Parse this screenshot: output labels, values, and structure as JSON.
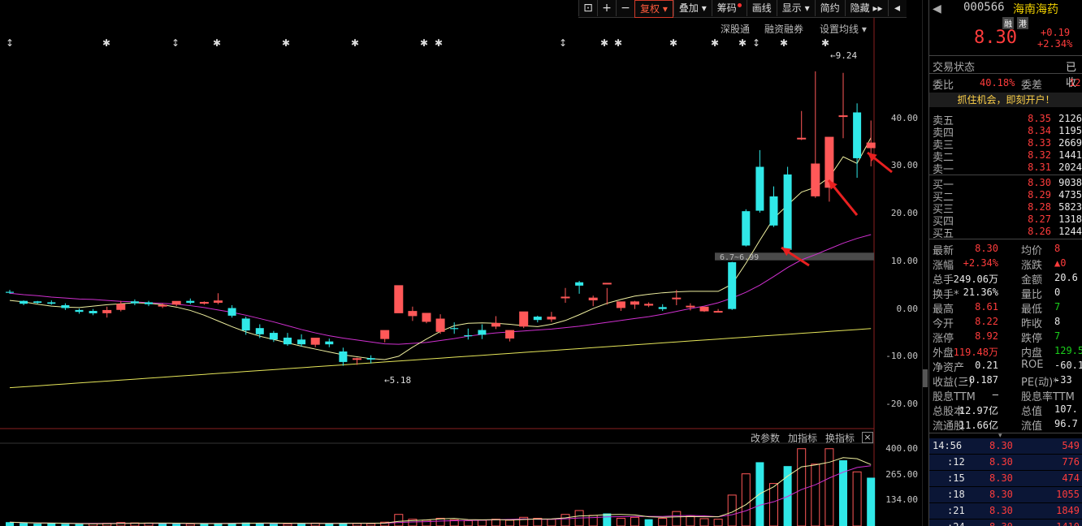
{
  "toolbar": {
    "buttons": [
      "+",
      "−"
    ],
    "fuquan": "复权",
    "diejia": "叠加",
    "choumа": "筹码",
    "huaxian": "画线",
    "xianshi": "显示",
    "jianyue": "简约",
    "yincang": "隐藏"
  },
  "chart_links": {
    "shengutong": "深股通",
    "rongzi": "融资融券",
    "junxian": "设置均线"
  },
  "annotations": {
    "high": "9.24",
    "low": "5.18",
    "range": "6.7~6.99"
  },
  "price_axis": [
    "40.00",
    "30.00",
    "20.00",
    "10.00",
    "0.00",
    "-10.00",
    "-20.00"
  ],
  "vol_axis": [
    "400.00",
    "265.00",
    "134.00"
  ],
  "indicator_bar": {
    "gaicanshu": "改参数",
    "jiazhibiao": "加指标",
    "huanzhibiao": "换指标",
    "close": "×"
  },
  "stock": {
    "code": "000566",
    "name": "海南海药",
    "tag_rong": "融",
    "tag_gang": "港",
    "price": "8.30",
    "change": "+0.19",
    "change_pct": "+2.34%"
  },
  "trade_status": {
    "label": "交易状态",
    "value": "已收"
  },
  "weibi": {
    "label": "委比",
    "value": "40.18%",
    "label2": "委差",
    "value2": "12"
  },
  "promo": "抓住机会，即刻开户！",
  "asks": [
    {
      "label": "卖五",
      "price": "8.35",
      "vol": "2126"
    },
    {
      "label": "卖四",
      "price": "8.34",
      "vol": "1195"
    },
    {
      "label": "卖三",
      "price": "8.33",
      "vol": "2669"
    },
    {
      "label": "卖二",
      "price": "8.32",
      "vol": "1441"
    },
    {
      "label": "卖一",
      "price": "8.31",
      "vol": "2024"
    }
  ],
  "bids": [
    {
      "label": "买一",
      "price": "8.30",
      "vol": "9038"
    },
    {
      "label": "买二",
      "price": "8.29",
      "vol": "4735"
    },
    {
      "label": "买三",
      "price": "8.28",
      "vol": "5823"
    },
    {
      "label": "买四",
      "price": "8.27",
      "vol": "1318"
    },
    {
      "label": "买五",
      "price": "8.26",
      "vol": "1244"
    }
  ],
  "stats": [
    {
      "l": "最新",
      "v": "8.30",
      "vc": "red",
      "l2": "均价",
      "v2": "8",
      "v2c": "red"
    },
    {
      "l": "涨幅",
      "v": "+2.34%",
      "vc": "red",
      "l2": "涨跌",
      "v2": "▲0",
      "v2c": "red"
    },
    {
      "l": "总手",
      "v": "249.06万",
      "vc": "white",
      "l2": "金额",
      "v2": "20.6",
      "v2c": "white"
    },
    {
      "l": "换手*",
      "v": "21.36%",
      "vc": "white",
      "l2": "量比",
      "v2": "0",
      "v2c": "white"
    },
    {
      "l": "最高",
      "v": "8.61",
      "vc": "red",
      "l2": "最低",
      "v2": "7",
      "v2c": "green"
    },
    {
      "l": "今开",
      "v": "8.22",
      "vc": "red",
      "l2": "昨收",
      "v2": "8",
      "v2c": "white"
    },
    {
      "l": "涨停",
      "v": "8.92",
      "vc": "red",
      "l2": "跌停",
      "v2": "7",
      "v2c": "green"
    },
    {
      "l": "外盘",
      "v": "119.48万",
      "vc": "red",
      "l2": "内盘",
      "v2": "129.5",
      "v2c": "green"
    },
    {
      "l": "净资产",
      "v": "0.21",
      "vc": "white",
      "l2": "ROE",
      "v2": "-60.1",
      "v2c": "white"
    },
    {
      "l": "收益(三)",
      "v": "-0.187",
      "vc": "white",
      "l2": "PE(动)*",
      "v2": "-33",
      "v2c": "white"
    },
    {
      "l": "股息TTM",
      "v": "—",
      "vc": "white",
      "l2": "股息率TTM",
      "v2": "",
      "v2c": "white"
    },
    {
      "l": "总股本",
      "v": "12.97亿",
      "vc": "white",
      "l2": "总值",
      "v2": "107.",
      "v2c": "white"
    },
    {
      "l": "流通股",
      "v": "11.66亿",
      "vc": "white",
      "l2": "流值",
      "v2": "96.7",
      "v2c": "white"
    }
  ],
  "ticks": [
    {
      "t": "14:56",
      "p": "8.30",
      "v": "549"
    },
    {
      "t": ":12",
      "p": "8.30",
      "v": "776"
    },
    {
      "t": ":15",
      "p": "8.30",
      "v": "474"
    },
    {
      "t": ":18",
      "p": "8.30",
      "v": "1055"
    },
    {
      "t": ":21",
      "p": "8.30",
      "v": "1849"
    },
    {
      "t": ":24",
      "p": "8.30",
      "v": "1410"
    }
  ],
  "chart_data": {
    "type": "candlestick",
    "candles": [
      [
        3.6,
        4.0,
        3.4,
        3.2
      ],
      [
        1.7,
        1.8,
        1.1,
        0.8
      ],
      [
        1.6,
        1.7,
        1.3,
        1.1
      ],
      [
        1.4,
        1.8,
        1.1,
        0.9
      ],
      [
        0.8,
        1.2,
        0.2,
        -0.2
      ],
      [
        -0.2,
        0.1,
        -0.6,
        -1.0
      ],
      [
        -0.4,
        0.0,
        -0.9,
        -1.3
      ],
      [
        -0.8,
        0.5,
        -0.3,
        -1.8
      ],
      [
        -0.1,
        1.7,
        1.0,
        -0.5
      ],
      [
        1.6,
        2.0,
        1.2,
        0.8
      ],
      [
        1.4,
        1.7,
        1.0,
        0.6
      ],
      [
        0.6,
        1.2,
        0.8,
        0.2
      ],
      [
        1.0,
        1.5,
        1.6,
        0.6
      ],
      [
        1.7,
        2.2,
        1.3,
        1.0
      ],
      [
        1.2,
        1.6,
        1.4,
        0.9
      ],
      [
        1.4,
        3.3,
        1.7,
        1.0
      ],
      [
        0.2,
        0.8,
        -1.4,
        -1.8
      ],
      [
        -2.0,
        -1.6,
        -4.5,
        -5.4
      ],
      [
        -4.0,
        -3.2,
        -5.3,
        -6.1
      ],
      [
        -5.0,
        -4.6,
        -6.4,
        -6.9
      ],
      [
        -6.0,
        -5.0,
        -7.4,
        -7.7
      ],
      [
        -6.4,
        -5.3,
        -7.4,
        -7.9
      ],
      [
        -7.4,
        -6.6,
        -6.1,
        -8.0
      ],
      [
        -6.8,
        -6.2,
        -7.4,
        -8.0
      ],
      [
        -8.9,
        -8.1,
        -11.1,
        -11.9
      ],
      [
        -10.5,
        -10.2,
        -10.4,
        -11.7
      ],
      [
        -10.3,
        -9.7,
        -10.6,
        -11.4
      ],
      [
        -6.2,
        -5.6,
        -4.5,
        -7.0
      ],
      [
        -0.8,
        -0.2,
        4.9,
        -0.3
      ],
      [
        -1.4,
        0.5,
        -0.5,
        -2.5
      ],
      [
        -2.6,
        -1.8,
        -0.9,
        -3.0
      ],
      [
        -4.7,
        -1.1,
        -2.1,
        -5.2
      ],
      [
        -4.0,
        -2.8,
        -4.2,
        -5.2
      ],
      [
        -5.5,
        -4.1,
        -5.7,
        -6.4
      ],
      [
        -4.4,
        -3.2,
        -5.4,
        -6.3
      ],
      [
        -3.6,
        -1.5,
        -3.0,
        -4.2
      ],
      [
        -6.1,
        -5.4,
        -4.5,
        -6.8
      ],
      [
        -3.6,
        -3.2,
        -0.6,
        -4.0
      ],
      [
        -1.6,
        -1.4,
        -2.3,
        -2.8
      ],
      [
        -2.1,
        -0.6,
        -1.7,
        -2.7
      ],
      [
        2.5,
        4.4,
        2.5,
        1.3
      ],
      [
        5.6,
        5.9,
        4.9,
        3.2
      ],
      [
        1.9,
        2.8,
        2.3,
        0.6
      ],
      [
        5.4,
        4.4,
        5.4,
        0.9
      ],
      [
        0.3,
        1.5,
        1.5,
        -0.4
      ],
      [
        1.0,
        1.7,
        1.5,
        0.0
      ],
      [
        0.8,
        1.4,
        1.0,
        0.4
      ],
      [
        0.4,
        1.0,
        0.0,
        -0.4
      ],
      [
        2.3,
        4.0,
        2.3,
        0.8
      ],
      [
        0.5,
        1.2,
        0.6,
        -0.3
      ],
      [
        -0.4,
        0.0,
        0.4,
        -0.6
      ],
      [
        -0.5,
        0.0,
        -0.5,
        -0.6
      ],
      [
        9.8,
        9.9,
        0.0,
        -0.2
      ],
      [
        20.5,
        20.9,
        13.3,
        13.1
      ],
      [
        29.8,
        33.3,
        20.6,
        20.2
      ],
      [
        23.6,
        25.7,
        17.5,
        17.2
      ],
      [
        28.2,
        29.8,
        12.4,
        11.9
      ],
      [
        35.8,
        41.5,
        35.8,
        35.4
      ],
      [
        23.7,
        49.8,
        30.4,
        23.3
      ],
      [
        25.5,
        36.0,
        36.0,
        22.5
      ],
      [
        40.5,
        49.5,
        40.5,
        35.8
      ],
      [
        41.2,
        43.1,
        31.6,
        27.5
      ],
      [
        33.8,
        39.5,
        34.8,
        29.9
      ]
    ],
    "ma5": [
      1.8,
      1.5,
      1.0,
      0.6,
      0.4,
      0.3,
      0.6,
      0.9,
      1.1,
      1.3,
      1.2,
      0.9,
      0.4,
      -0.3,
      -1.3,
      -2.5,
      -3.7,
      -4.8,
      -5.7,
      -6.4,
      -7.1,
      -7.8,
      -8.4,
      -9.0,
      -9.6,
      -10.0,
      -10.4,
      -10.6,
      -9.9,
      -8.0,
      -6.3,
      -4.7,
      -3.5,
      -3.0,
      -2.9,
      -3.0,
      -3.2,
      -3.5,
      -3.7,
      -3.2,
      -2.4,
      -1.2,
      0.1,
      1.2,
      2.0,
      2.7,
      3.1,
      3.4,
      3.6,
      3.7,
      3.7,
      3.7,
      5.2,
      9.6,
      14.4,
      19.0,
      21.8,
      24.5,
      25.5,
      27.6,
      31.9,
      30.5,
      35.9
    ],
    "ma10": [
      3.3,
      3.0,
      2.8,
      2.5,
      2.3,
      2.1,
      2.0,
      1.8,
      1.6,
      1.5,
      1.3,
      1.2,
      1.0,
      0.7,
      0.3,
      -0.2,
      -0.7,
      -1.3,
      -2.0,
      -2.7,
      -3.5,
      -4.3,
      -5.0,
      -5.6,
      -6.1,
      -6.5,
      -6.9,
      -7.3,
      -7.4,
      -7.2,
      -7.0,
      -6.6,
      -6.2,
      -5.7,
      -5.3,
      -5.0,
      -4.8,
      -4.6,
      -4.4,
      -4.2,
      -3.9,
      -3.6,
      -3.2,
      -2.8,
      -2.4,
      -2.0,
      -1.6,
      -1.1,
      -0.5,
      0.1,
      0.6,
      1.3,
      2.3,
      3.5,
      5.0,
      6.8,
      8.7,
      10.3,
      11.4,
      12.6,
      13.8,
      14.8,
      15.6
    ],
    "ma60": [
      -16.5,
      -16.3,
      -16.1,
      -15.9,
      -15.7,
      -15.5,
      -15.3,
      -15.1,
      -14.9,
      -14.7,
      -14.5,
      -14.3,
      -14.1,
      -13.9,
      -13.7,
      -13.5,
      -13.3,
      -13.1,
      -12.9,
      -12.7,
      -12.5,
      -12.3,
      -12.1,
      -11.9,
      -11.7,
      -11.5,
      -11.3,
      -11.1,
      -10.9,
      -10.7,
      -10.5,
      -10.3,
      -10.1,
      -9.9,
      -9.7,
      -9.5,
      -9.3,
      -9.1,
      -8.9,
      -8.7,
      -8.5,
      -8.3,
      -8.1,
      -7.9,
      -7.7,
      -7.5,
      -7.3,
      -7.1,
      -6.9,
      -6.7,
      -6.5,
      -6.3,
      -6.1,
      -5.9,
      -5.7,
      -5.5,
      -5.3,
      -5.1,
      -4.9,
      -4.7,
      -4.5,
      -4.3,
      -4.1
    ],
    "volumes": [
      20,
      15,
      12,
      14,
      11,
      10,
      12,
      14,
      18,
      16,
      15,
      13,
      12,
      11,
      13,
      15,
      14,
      18,
      16,
      12,
      11,
      13,
      15,
      14,
      16,
      13,
      12,
      20,
      60,
      35,
      30,
      40,
      32,
      28,
      30,
      35,
      30,
      45,
      40,
      35,
      60,
      80,
      55,
      65,
      40,
      45,
      35,
      40,
      75,
      50,
      38,
      35,
      160,
      270,
      330,
      220,
      310,
      400,
      320,
      400,
      340,
      280,
      250
    ],
    "vol_up": [
      false,
      false,
      false,
      false,
      false,
      false,
      true,
      true,
      true,
      true,
      true,
      false,
      false,
      true,
      false,
      false,
      false,
      false,
      false,
      false,
      true,
      false,
      true,
      false,
      false,
      true,
      true,
      true,
      true,
      true,
      true,
      true,
      true,
      true,
      true,
      true,
      true,
      true,
      true,
      true,
      true,
      true,
      true,
      false,
      true,
      true,
      false,
      true,
      true,
      true,
      true,
      true,
      true,
      true,
      false,
      true,
      false,
      true,
      true,
      true,
      false,
      true,
      false,
      true,
      true
    ],
    "yrange": [
      -22,
      52
    ],
    "vrange": [
      0,
      420
    ]
  }
}
